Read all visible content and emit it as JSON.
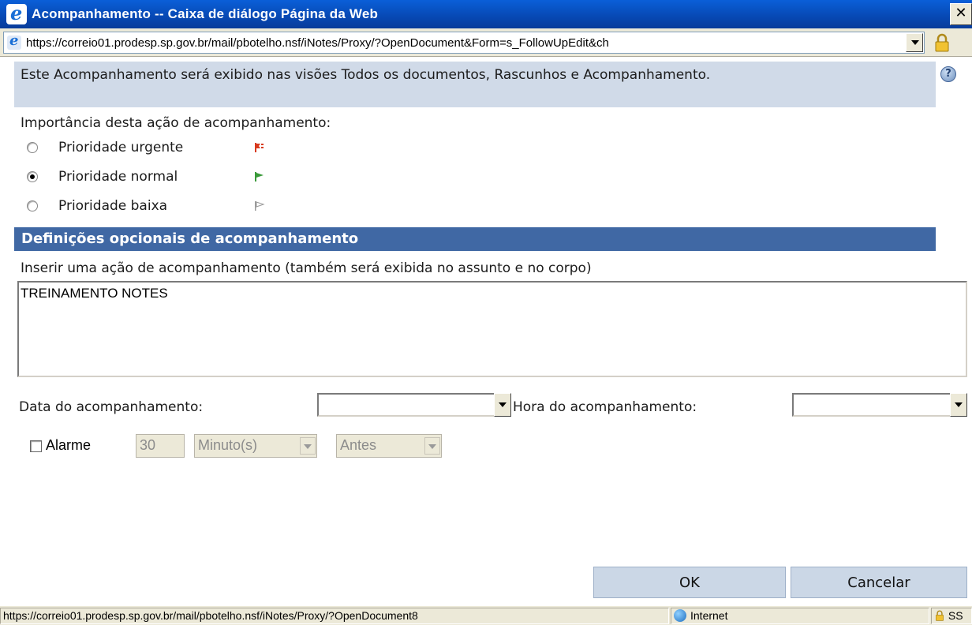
{
  "window": {
    "title": "Acompanhamento -- Caixa de diálogo Página da Web",
    "close_glyph": "✕"
  },
  "address_bar": {
    "url": "https://correio01.prodesp.sp.gov.br/mail/pbotelho.nsf/iNotes/Proxy/?OpenDocument&Form=s_FollowUpEdit&ch"
  },
  "info": {
    "text": "Este Acompanhamento será exibido nas visões Todos os documentos, Rascunhos e Acompanhamento.",
    "help_glyph": "?"
  },
  "importance": {
    "label": "Importância desta ação de acompanhamento:",
    "options": [
      {
        "label": "Prioridade urgente",
        "selected": false,
        "flag_color": "#d83a1e",
        "icon": "flag-urgent-icon"
      },
      {
        "label": "Prioridade normal",
        "selected": true,
        "flag_color": "#3a9a3a",
        "icon": "flag-normal-icon"
      },
      {
        "label": "Prioridade baixa",
        "selected": false,
        "flag_color": "#9a9a9a",
        "icon": "flag-low-icon"
      }
    ]
  },
  "optional": {
    "header": "Definições opcionais de acompanhamento",
    "insert_label": "Inserir uma ação de acompanhamento (também será exibida no assunto e no corpo)",
    "action_value": "TREINAMENTO NOTES",
    "date_label": "Data do acompanhamento:",
    "date_value": "",
    "time_label": "Hora do acompanhamento:",
    "time_value": ""
  },
  "alarm": {
    "checked": false,
    "label": "Alarme",
    "amount": "30",
    "unit": "Minuto(s)",
    "when": "Antes"
  },
  "buttons": {
    "ok": "OK",
    "cancel": "Cancelar"
  },
  "status_bar": {
    "url": "https://correio01.prodesp.sp.gov.br/mail/pbotelho.nsf/iNotes/Proxy/?OpenDocument8",
    "zone": "Internet",
    "extra": "SS"
  },
  "colors": {
    "section_header": "#4068a4",
    "info_box": "#d0dae8",
    "button": "#cbd7e6"
  }
}
